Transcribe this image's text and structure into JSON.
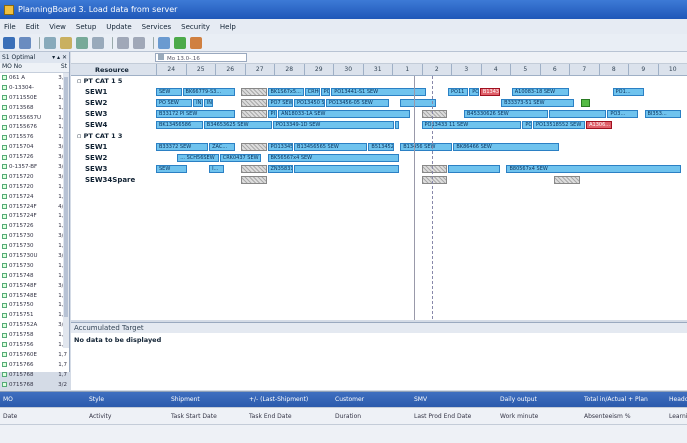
{
  "window": {
    "title": "PlanningBoard 3. Load data from server"
  },
  "menu": [
    "File",
    "Edit",
    "View",
    "Setup",
    "Update",
    "Services",
    "Security",
    "Help"
  ],
  "left": {
    "header": "S1 Optimal",
    "col_mo": "MO No",
    "col_status": "St",
    "rows": [
      [
        "061 A",
        "3,0"
      ],
      [
        "0-13304-",
        "1,7"
      ],
      [
        "0711550E",
        "1,7"
      ],
      [
        "0713568",
        "1,7"
      ],
      [
        "07155657U",
        "1,7"
      ],
      [
        "07155676",
        "1,7"
      ],
      [
        "0715576",
        "1,7"
      ],
      [
        "0715704",
        "3/2"
      ],
      [
        "0715726",
        "3/2"
      ],
      [
        "0-1357-BF",
        "3/2"
      ],
      [
        "0715720",
        "3/2"
      ],
      [
        "0715720",
        "1,7"
      ],
      [
        "0715724",
        "1,7"
      ],
      [
        "0715724F",
        "4/2"
      ],
      [
        "0715724F",
        "1,7"
      ],
      [
        "0715726",
        "1,7"
      ],
      [
        "0715730",
        "3/2"
      ],
      [
        "0715730",
        "1,7"
      ],
      [
        "0715730U",
        "3/2"
      ],
      [
        "0715730",
        "1,7"
      ],
      [
        "0715748",
        "1,7"
      ],
      [
        "0715748F",
        "3/2"
      ],
      [
        "0715748E",
        "1,7"
      ],
      [
        "0715750",
        "1,7"
      ],
      [
        "0715751",
        "1,7"
      ],
      [
        "0715752A",
        "3/2"
      ],
      [
        "0715758",
        "1,7"
      ],
      [
        "0715756",
        "1,7"
      ],
      [
        "0715760E",
        "1,7"
      ],
      [
        "0715766",
        "1,7"
      ],
      [
        "0715768",
        "1,7"
      ],
      [
        "0715768",
        "3/2"
      ]
    ]
  },
  "gantt": {
    "date_field": "Mo 13.0-.16",
    "resource_header": "Resource",
    "days": [
      "24",
      "25",
      "26",
      "27",
      "28",
      "29",
      "30",
      "31",
      "1",
      "2",
      "3",
      "4",
      "5",
      "6",
      "7",
      "8",
      "9",
      "10"
    ],
    "groups": [
      {
        "label": "PT CAT 1 5",
        "rows": [
          {
            "name": "SEW1",
            "bars": [
              {
                "t": "SEW",
                "s": 0,
                "w": 0.05
              },
              {
                "t": "BK66779-S3...",
                "s": 0.05,
                "w": 0.1
              },
              {
                "t": "",
                "s": 0.16,
                "w": 0.05,
                "k": "hat"
              },
              {
                "t": "BK1S67x5...",
                "s": 0.21,
                "w": 0.07
              },
              {
                "t": "CRH0...",
                "s": 0.28,
                "w": 0.03
              },
              {
                "t": "PO",
                "s": 0.31,
                "w": 0.02
              },
              {
                "t": "PO13441-S1 SEW",
                "s": 0.33,
                "w": 0.18
              },
              {
                "t": "PO11",
                "s": 0.55,
                "w": 0.04
              },
              {
                "t": "PO",
                "s": 0.59,
                "w": 0.02
              },
              {
                "t": "B13436...",
                "s": 0.61,
                "w": 0.04,
                "k": "red"
              },
              {
                "t": "A10083-18 SEW",
                "s": 0.67,
                "w": 0.11
              },
              {
                "t": "PO1...",
                "s": 0.86,
                "w": 0.06
              }
            ]
          },
          {
            "name": "SEW2",
            "bars": [
              {
                "t": "PO SEW",
                "s": 0,
                "w": 0.07
              },
              {
                "t": "IN",
                "s": 0.07,
                "w": 0.02
              },
              {
                "t": "IN",
                "s": 0.09,
                "w": 0.02
              },
              {
                "t": "",
                "s": 0.16,
                "w": 0.05,
                "k": "hat"
              },
              {
                "t": "PO7 SEW",
                "s": 0.21,
                "w": 0.05
              },
              {
                "t": "PO13450 SEW",
                "s": 0.26,
                "w": 0.06
              },
              {
                "t": "PO13456-05 SEW",
                "s": 0.32,
                "w": 0.12
              },
              {
                "t": "",
                "s": 0.46,
                "w": 0.07
              },
              {
                "t": "B33373-51 SEW",
                "s": 0.65,
                "w": 0.14
              },
              {
                "t": "",
                "s": 0.8,
                "w": 0.02,
                "k": "green"
              }
            ]
          },
          {
            "name": "SEW3",
            "bars": [
              {
                "t": "B33172 PI SEW",
                "s": 0,
                "w": 0.15
              },
              {
                "t": "",
                "s": 0.16,
                "w": 0.05,
                "k": "hat"
              },
              {
                "t": "PI",
                "s": 0.21,
                "w": 0.02
              },
              {
                "t": "AN18033-1A SEW",
                "s": 0.23,
                "w": 0.25
              },
              {
                "t": "",
                "s": 0.5,
                "w": 0.05,
                "k": "hat"
              },
              {
                "t": "B45330626 SEW",
                "s": 0.58,
                "w": 0.16
              },
              {
                "t": "",
                "s": 0.74,
                "w": 0.11
              },
              {
                "t": "PO3...",
                "s": 0.85,
                "w": 0.06
              },
              {
                "t": "BI353...",
                "s": 0.92,
                "w": 0.07
              }
            ]
          },
          {
            "name": "SEW4",
            "bars": [
              {
                "t": "BK13456586",
                "s": 0,
                "w": 0.09
              },
              {
                "t": "B34653625 SEW",
                "s": 0.09,
                "w": 0.13
              },
              {
                "t": "PO13349-1D SEW",
                "s": 0.22,
                "w": 0.23
              },
              {
                "t": "",
                "s": 0.45,
                "w": 0.01
              },
              {
                "t": "PO13433 11 SEW",
                "s": 0.5,
                "w": 0.19
              },
              {
                "t": "PO",
                "s": 0.69,
                "w": 0.02
              },
              {
                "t": "PO13518552 SEW",
                "s": 0.71,
                "w": 0.1
              },
              {
                "t": "A1306...",
                "s": 0.81,
                "w": 0.05,
                "k": "red"
              }
            ]
          }
        ]
      },
      {
        "label": "PT CAT 1 3",
        "rows": [
          {
            "name": "SEW1",
            "bars": [
              {
                "t": "B33372 SEW",
                "s": 0,
                "w": 0.1
              },
              {
                "t": "ZAC...",
                "s": 0.1,
                "w": 0.05
              },
              {
                "t": "",
                "s": 0.16,
                "w": 0.05,
                "k": "hat"
              },
              {
                "t": "PO133452...",
                "s": 0.21,
                "w": 0.05
              },
              {
                "t": "B13456565 SEW",
                "s": 0.26,
                "w": 0.14
              },
              {
                "t": "B513452...",
                "s": 0.4,
                "w": 0.05
              },
              {
                "t": "B13456 SEW",
                "s": 0.46,
                "w": 0.1
              },
              {
                "t": "BK86466 SEW",
                "s": 0.56,
                "w": 0.2
              }
            ]
          },
          {
            "name": "SEW2",
            "bars": [
              {
                "t": "... SCH56SEW",
                "s": 0.04,
                "w": 0.08
              },
              {
                "t": "CRK0437 SEW",
                "s": 0.12,
                "w": 0.08
              },
              {
                "t": "BK56567x4 SEW",
                "s": 0.21,
                "w": 0.25
              }
            ]
          },
          {
            "name": "SEW3",
            "bars": [
              {
                "t": "SEW",
                "s": 0,
                "w": 0.06
              },
              {
                "t": "I...",
                "s": 0.1,
                "w": 0.03
              },
              {
                "t": "",
                "s": 0.16,
                "w": 0.05,
                "k": "hat"
              },
              {
                "t": "ZN35831...",
                "s": 0.21,
                "w": 0.05
              },
              {
                "t": "",
                "s": 0.26,
                "w": 0.2
              },
              {
                "t": "",
                "s": 0.5,
                "w": 0.05,
                "k": "hat"
              },
              {
                "t": "",
                "s": 0.55,
                "w": 0.1
              },
              {
                "t": "B80567x4 SEW",
                "s": 0.66,
                "w": 0.33
              }
            ]
          },
          {
            "name": "SEW34Spare",
            "bars": [
              {
                "t": "",
                "s": 0.16,
                "w": 0.05,
                "k": "hat"
              },
              {
                "t": "",
                "s": 0.5,
                "w": 0.05,
                "k": "hat"
              },
              {
                "t": "",
                "s": 0.75,
                "w": 0.05,
                "k": "hat"
              }
            ]
          }
        ]
      }
    ]
  },
  "accumulated": {
    "title": "Accumulated Target",
    "message": "No data to be displayed"
  },
  "bottom": {
    "row1": [
      "MO",
      "Style",
      "Shipment",
      "+/- (Last-Shipment)",
      "Customer",
      "SMV",
      "Daily output",
      "Total in/Actual + Plan",
      "Headcount"
    ],
    "row2": [
      "Date",
      "Activity",
      "Task Start Date",
      "Task End Date",
      "Duration",
      "Last Prod End Date",
      "Work minute",
      "Absenteeism %",
      "Learning %"
    ]
  },
  "colors": {
    "bar": "#6fc3ee",
    "alert": "#e0606a",
    "ok": "#55bb44",
    "title": "#2b62c4"
  }
}
